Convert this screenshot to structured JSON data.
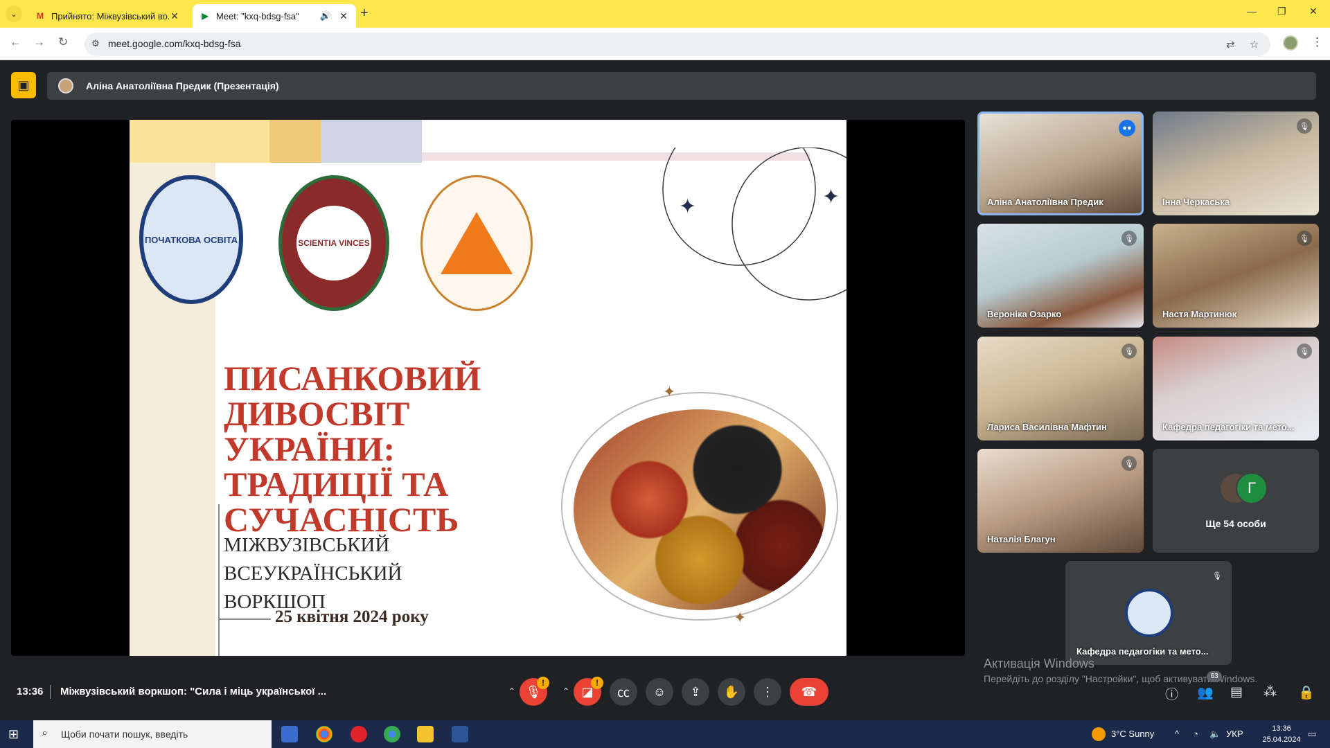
{
  "browser": {
    "tabs": [
      {
        "title": "Прийнято: Міжвузівський во...",
        "favicon": "gmail-icon"
      },
      {
        "title": "Meet: \"kxq-bdsg-fsa\"",
        "favicon": "meet-icon",
        "active": true
      }
    ],
    "url": "meet.google.com/kxq-bdsg-fsa",
    "accent": "#fde74c"
  },
  "presenter": {
    "label": "Аліна Анатоліївна Предик (Презентація)"
  },
  "slide": {
    "title_lines": [
      "ПИСАНКОВИЙ",
      "ДИВОСВІТ УКРАЇНИ:",
      "ТРАДИЦІЇ ТА",
      "СУЧАСНІСТЬ"
    ],
    "subtitle_lines": [
      "МІЖВУЗІВСЬКИЙ ВСЕУКРАЇНСЬКИЙ",
      "ВОРКШОП"
    ],
    "date": "25 квітня 2024 року",
    "logo1_text": "ПОЧАТКОВА ОСВІТА",
    "logo2_text": "SCIENTIA VINCES",
    "title_color": "#c0392b"
  },
  "participants": [
    {
      "name": "Аліна Анатоліївна Предик",
      "speaking": true
    },
    {
      "name": "Інна Черкаська",
      "muted": true
    },
    {
      "name": "Вероніка Озарко",
      "muted": true
    },
    {
      "name": "Настя Мартинюк",
      "muted": true
    },
    {
      "name": "Лариса Василівна Мафтин",
      "muted": true
    },
    {
      "name": "Кафедра педагогіки та мето...",
      "muted": true
    },
    {
      "name": "Наталія Благун",
      "muted": true
    }
  ],
  "more_people": {
    "avatar_letter": "Г",
    "label": "Ще 54 особи"
  },
  "dept_tile": {
    "name": "Кафедра педагогіки та мето..."
  },
  "watermark": {
    "title": "Активація Windows",
    "subtitle": "Перейдіть до розділу \"Настройки\", щоб активувати Windows."
  },
  "controls": {
    "time": "13:36",
    "meeting_title": "Міжвузівський воркшоп: \"Сила і міць української ...",
    "participants_count": "63"
  },
  "taskbar": {
    "search_placeholder": "Щоби почати пошук, введіть",
    "weather": "3°C  Sunny",
    "lang": "УКР",
    "time": "13:36",
    "date": "25.04.2024"
  }
}
